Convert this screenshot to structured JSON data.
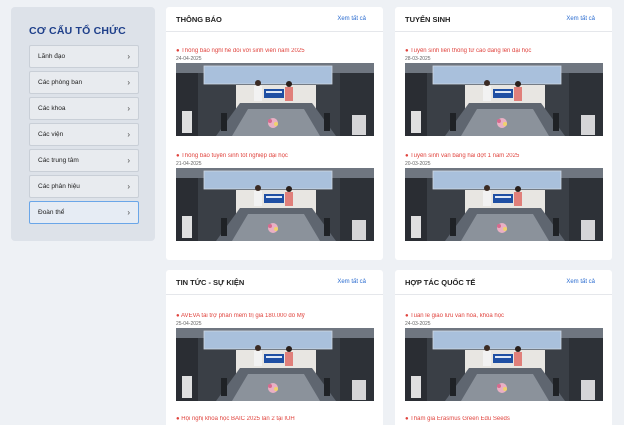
{
  "sidebar": {
    "title": "CƠ CẤU TỔ CHỨC",
    "items": [
      {
        "label": "Lãnh đạo"
      },
      {
        "label": "Các phòng ban"
      },
      {
        "label": "Các khoa"
      },
      {
        "label": "Các viện"
      },
      {
        "label": "Các trung tâm"
      },
      {
        "label": "Các phân hiệu"
      },
      {
        "label": "Đoàn thể"
      }
    ]
  },
  "sections": [
    {
      "title": "THÔNG BÁO",
      "see_all": "Xem tất cả",
      "entries": [
        {
          "title": "● Thông báo nghỉ hè đối với sinh viên năm 2025",
          "date": "24-04-2025"
        },
        {
          "title": "● Thông báo tuyển sinh tốt nghiệp đại học",
          "date": "21-04-2025"
        }
      ]
    },
    {
      "title": "TUYỂN SINH",
      "see_all": "Xem tất cả",
      "entries": [
        {
          "title": "● Tuyển sinh liên thông từ cao đẳng lên đại học",
          "date": "28-03-2025"
        },
        {
          "title": "● Tuyển sinh văn bằng hai đợt 1 năm 2025",
          "date": "20-03-2025"
        }
      ]
    },
    {
      "title": "TIN TỨC - SỰ KIỆN",
      "see_all": "Xem tất cả",
      "entries": [
        {
          "title": "● AVEVA tài trợ phần mềm trị giá 180.000 đô Mỹ",
          "date": "25-04-2025"
        },
        {
          "title": "● Hội nghị khoa học BAIC 2025 lần 2 tại IUH",
          "date": ""
        }
      ]
    },
    {
      "title": "HỢP TÁC QUỐC TẾ",
      "see_all": "Xem tất cả",
      "entries": [
        {
          "title": "● Tuần lễ giao lưu văn hóa, khoa học",
          "date": "24-03-2025"
        },
        {
          "title": "● Tham gia Erasmus Green Edu Seeds",
          "date": ""
        }
      ]
    }
  ]
}
